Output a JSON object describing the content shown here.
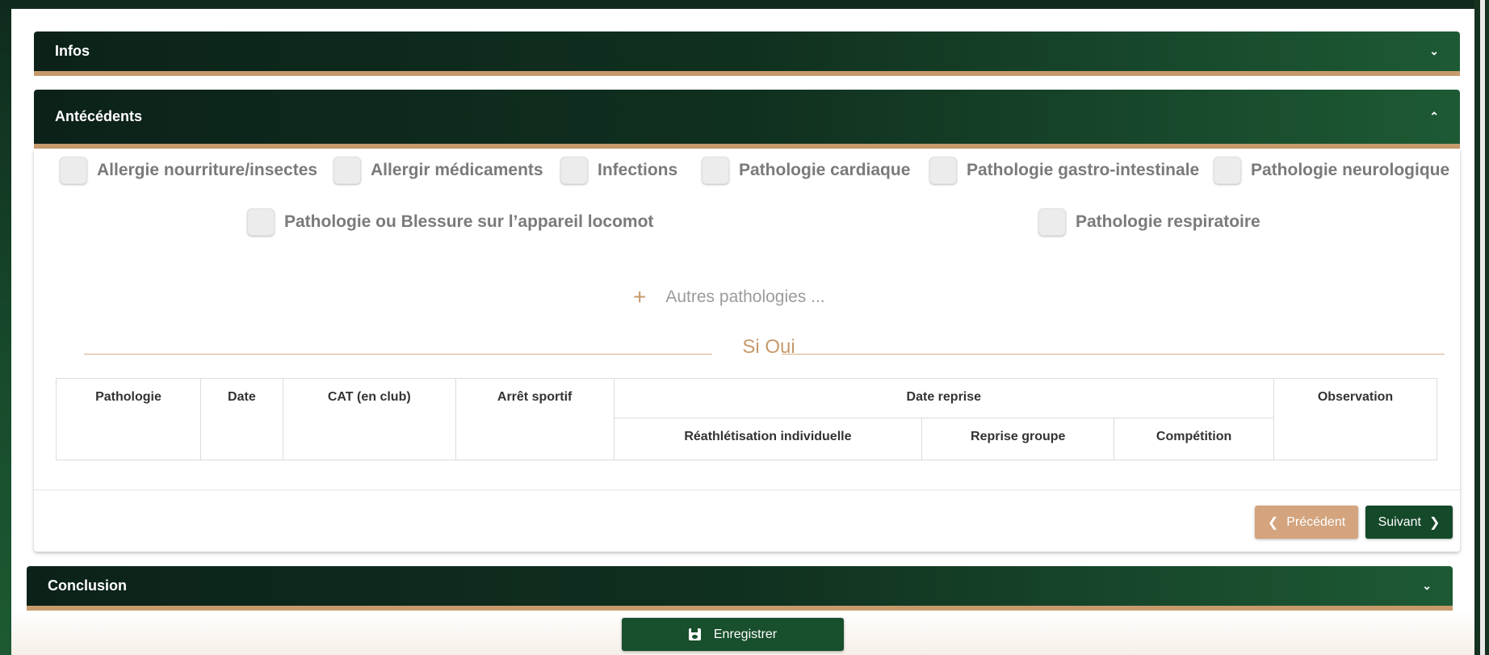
{
  "sections": {
    "infos": {
      "title": "Infos",
      "chevron": "chevron-down-icon",
      "expanded": false
    },
    "antecedents": {
      "title": "Antécédents",
      "chevron": "chevron-up-icon",
      "expanded": true
    },
    "conclusion": {
      "title": "Conclusion",
      "chevron": "chevron-down-icon",
      "expanded": false
    }
  },
  "checkboxes": [
    {
      "label": "Allergie nourriture/insectes",
      "checked": false
    },
    {
      "label": "Allergir médicaments",
      "checked": false
    },
    {
      "label": "Infections",
      "checked": false
    },
    {
      "label": "Pathologie cardiaque",
      "checked": false
    },
    {
      "label": "Pathologie gastro-intestinale",
      "checked": false
    },
    {
      "label": "Pathologie neurologique",
      "checked": false
    },
    {
      "label": "Pathologie ou Blessure sur l’appareil locomot",
      "checked": false
    },
    {
      "label": "Pathologie respiratoire",
      "checked": false
    }
  ],
  "other": {
    "icon": "+",
    "label": "Autres pathologies ..."
  },
  "si_oui": "Si Oui",
  "table": {
    "headers": {
      "pathologie": "Pathologie",
      "date": "Date",
      "cat": "CAT (en club)",
      "arret": "Arrêt sportif",
      "date_reprise": "Date reprise",
      "observation": "Observation"
    },
    "sub_headers": {
      "reathletisation": "Réathlétisation individuelle",
      "reprise_groupe": "Reprise groupe",
      "competition": "Compétition"
    }
  },
  "nav": {
    "prev_label": "Précédent",
    "next_label": "Suivant"
  },
  "save_label": "Enregistrer",
  "colors": {
    "header_dark": "#0c2219",
    "header_accent": "#1d5a34",
    "tan": "#c79a6c",
    "save_green": "#184f2c"
  }
}
